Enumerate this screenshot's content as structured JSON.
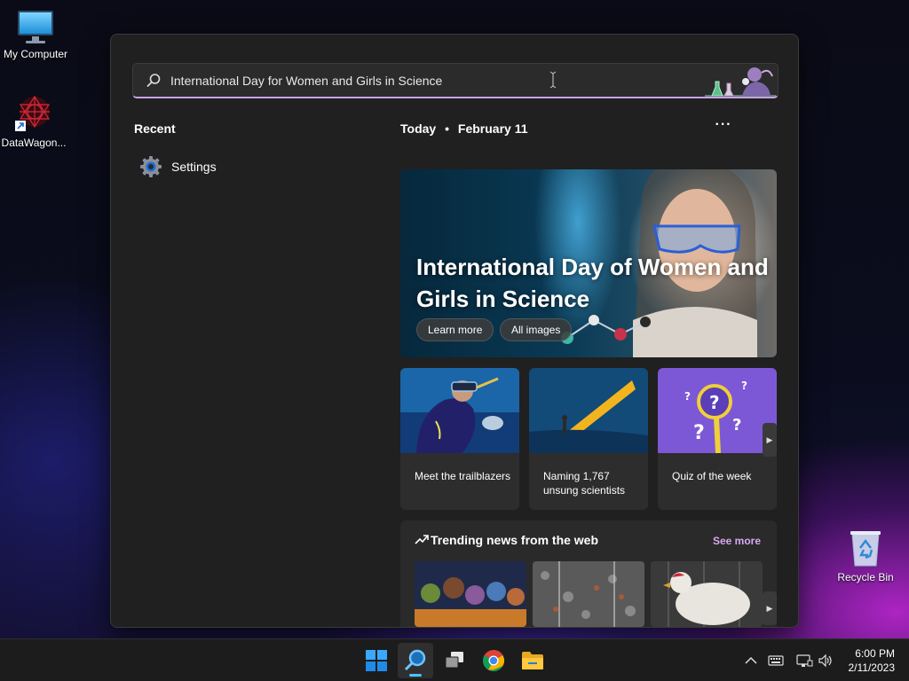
{
  "desktop": {
    "icons": [
      {
        "label": "My Computer",
        "icon": "monitor-icon"
      },
      {
        "label": "DataWagon...",
        "icon": "datawagon-icon"
      },
      {
        "label": "Recycle Bin",
        "icon": "recycle-bin-icon"
      }
    ]
  },
  "search": {
    "query": "International Day for Women and Girls in Science",
    "icon": "search-icon"
  },
  "recent": {
    "heading": "Recent",
    "items": [
      {
        "label": "Settings",
        "icon": "gear-icon"
      }
    ]
  },
  "highlights": {
    "day": "Today",
    "separator": "•",
    "date": "February 11",
    "more_icon": "more-icon",
    "more_label": "···",
    "hero": {
      "title": "International Day of Women and Girls in Science",
      "buttons": [
        "Learn more",
        "All images"
      ]
    },
    "cards": [
      {
        "caption": "Meet the trailblazers"
      },
      {
        "caption": "Naming 1,767 unsung scientists"
      },
      {
        "caption": "Quiz of the week"
      }
    ],
    "next_arrow": "▶"
  },
  "trending": {
    "title": "Trending news from the web",
    "see_more": "See more",
    "icon": "trending-icon"
  },
  "taskbar": {
    "apps": [
      "start-icon",
      "search-icon",
      "task-view-icon",
      "chrome-icon",
      "file-explorer-icon"
    ],
    "tray": [
      "chevron-up-icon",
      "keyboard-icon",
      "network-icon",
      "volume-icon"
    ],
    "time": "6:00 PM",
    "date": "2/11/2023"
  },
  "colors": {
    "accent": "#4cc2ff",
    "see_more": "#d6a8f0",
    "flyout_bg": "#202020"
  }
}
